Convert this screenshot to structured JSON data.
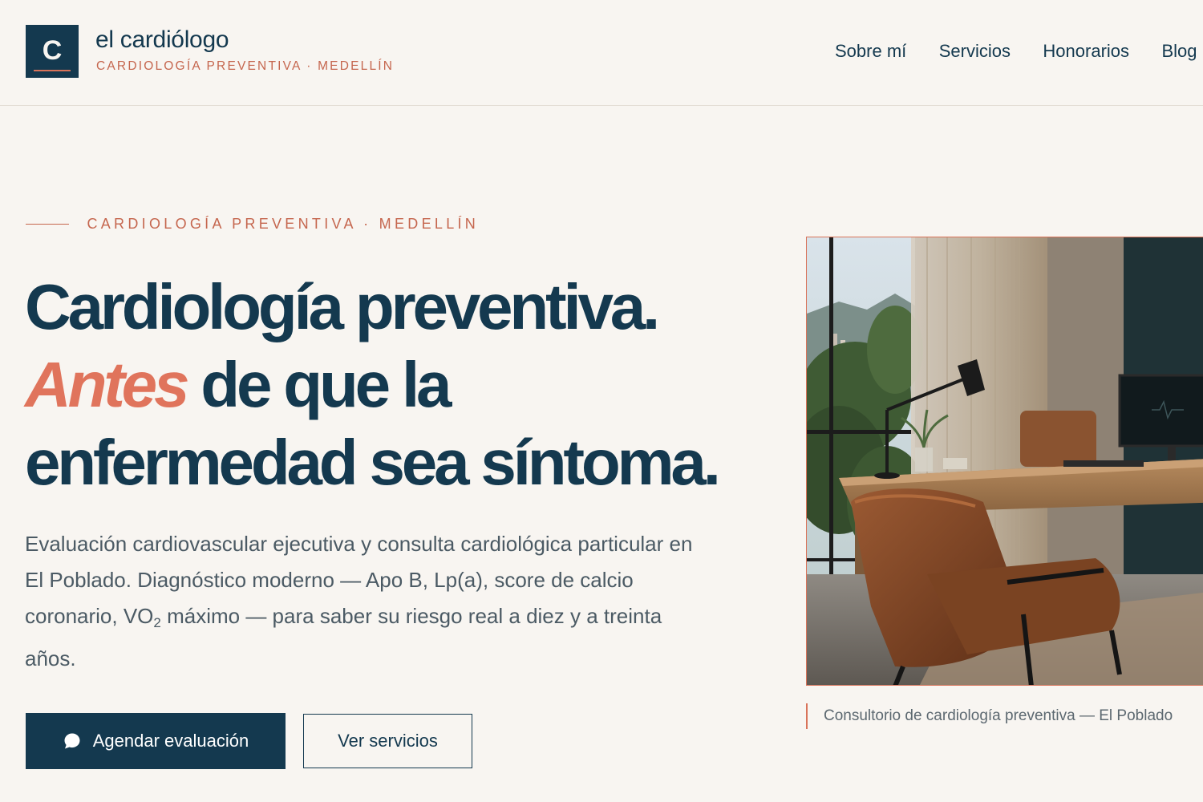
{
  "header": {
    "logo_letter": "C",
    "brand_name": "el cardiólogo",
    "brand_tagline": "CARDIOLOGÍA PREVENTIVA · MEDELLÍN",
    "nav": [
      "Sobre mí",
      "Servicios",
      "Honorarios",
      "Blog"
    ]
  },
  "hero": {
    "eyebrow": "CARDIOLOGÍA PREVENTIVA · MEDELLÍN",
    "headline_line1": "Cardiología preventiva.",
    "headline_accent": "Antes",
    "headline_line2_rest": " de que la",
    "headline_line3": "enfermedad sea síntoma.",
    "lead_before_sub": "Evaluación cardiovascular ejecutiva y consulta cardiológica particular en El Poblado. Diagnóstico moderno — Apo B, Lp(a), score de calcio coronario, VO",
    "lead_sub": "2",
    "lead_after_sub": " máximo — para saber su riesgo real a diez y a treinta años.",
    "cta_primary": "Agendar evaluación",
    "cta_secondary": "Ver servicios",
    "image_caption": "Consultorio de cardiología preventiva — El Poblado"
  },
  "icons": {
    "primary_button_icon": "chat-bubble-icon"
  },
  "colors": {
    "navy": "#14394f",
    "accent": "#e0745c",
    "background": "#f8f5f1"
  }
}
